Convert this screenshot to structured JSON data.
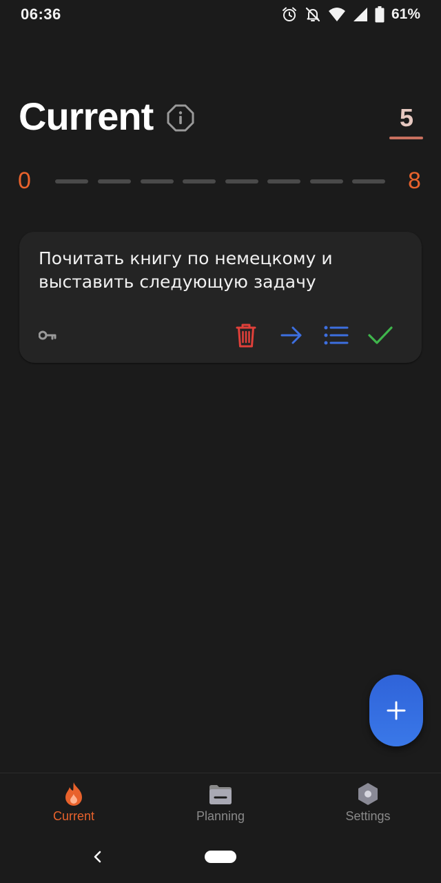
{
  "status_bar": {
    "time": "06:36",
    "battery": "61%",
    "icons": [
      "alarm-icon",
      "notifications-off-icon",
      "wifi-icon",
      "signal-icon",
      "battery-icon"
    ]
  },
  "header": {
    "title": "Current",
    "info_icon": "info-octagon-icon",
    "score": "5"
  },
  "progress": {
    "min": "0",
    "max": "8",
    "segments": 8
  },
  "task": {
    "text": "Почитать книгу по немецкому и выставить следующую задачу",
    "actions": [
      "delete",
      "move",
      "subtasks",
      "complete"
    ]
  },
  "fab": {
    "icon": "plus-icon"
  },
  "bottom_nav": {
    "items": [
      {
        "label": "Current",
        "icon": "fire-icon",
        "active": true
      },
      {
        "label": "Planning",
        "icon": "folder-icon",
        "active": false
      },
      {
        "label": "Settings",
        "icon": "hexagon-gear-icon",
        "active": false
      }
    ]
  },
  "colors": {
    "background": "#1b1b1b",
    "card": "#242424",
    "accent_orange": "#e8622c",
    "delete_red": "#e0403a",
    "action_blue": "#3d6fe0",
    "check_green": "#3fb54c",
    "fab_blue": "#3a78e8"
  }
}
